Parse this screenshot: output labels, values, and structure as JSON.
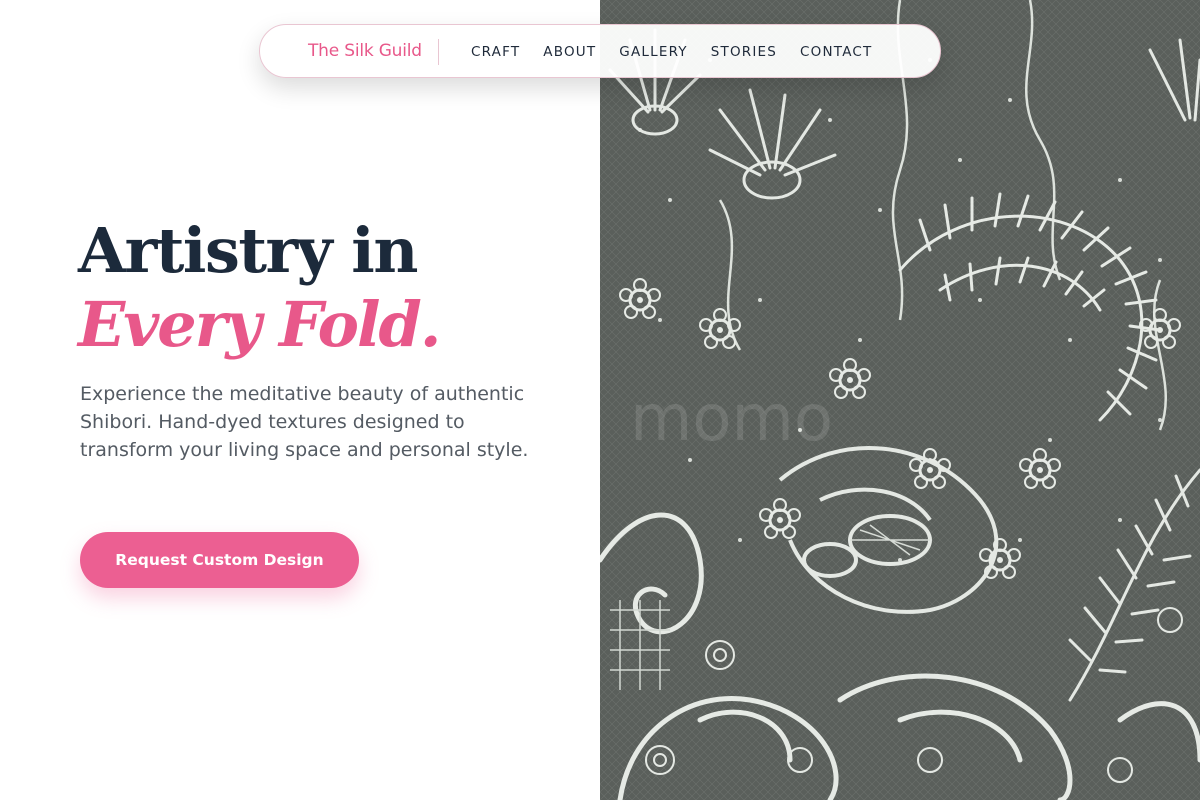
{
  "brand": {
    "name": "The Silk Guild",
    "color": "#e8588a"
  },
  "nav": {
    "links": [
      {
        "label": "CRAFT"
      },
      {
        "label": "ABOUT"
      },
      {
        "label": "GALLERY"
      },
      {
        "label": "STORIES"
      },
      {
        "label": "CONTACT"
      }
    ]
  },
  "hero": {
    "headline_line1": "Artistry in",
    "headline_line2": "Every Fold.",
    "lede": "Experience the meditative beauty of authentic Shibori. Hand-dyed textures designed to transform your living space and personal style.",
    "cta_label": "Request Custom Design",
    "image_alt": "Close-up of white floral lace on dark mesh",
    "image_watermark": "momo"
  },
  "colors": {
    "accent": "#e8588a",
    "cta": "#ec5f92",
    "heading": "#1c2a3b",
    "body_text": "#545b63",
    "image_bg": "#575c58",
    "lace": "#e4e8e3"
  }
}
